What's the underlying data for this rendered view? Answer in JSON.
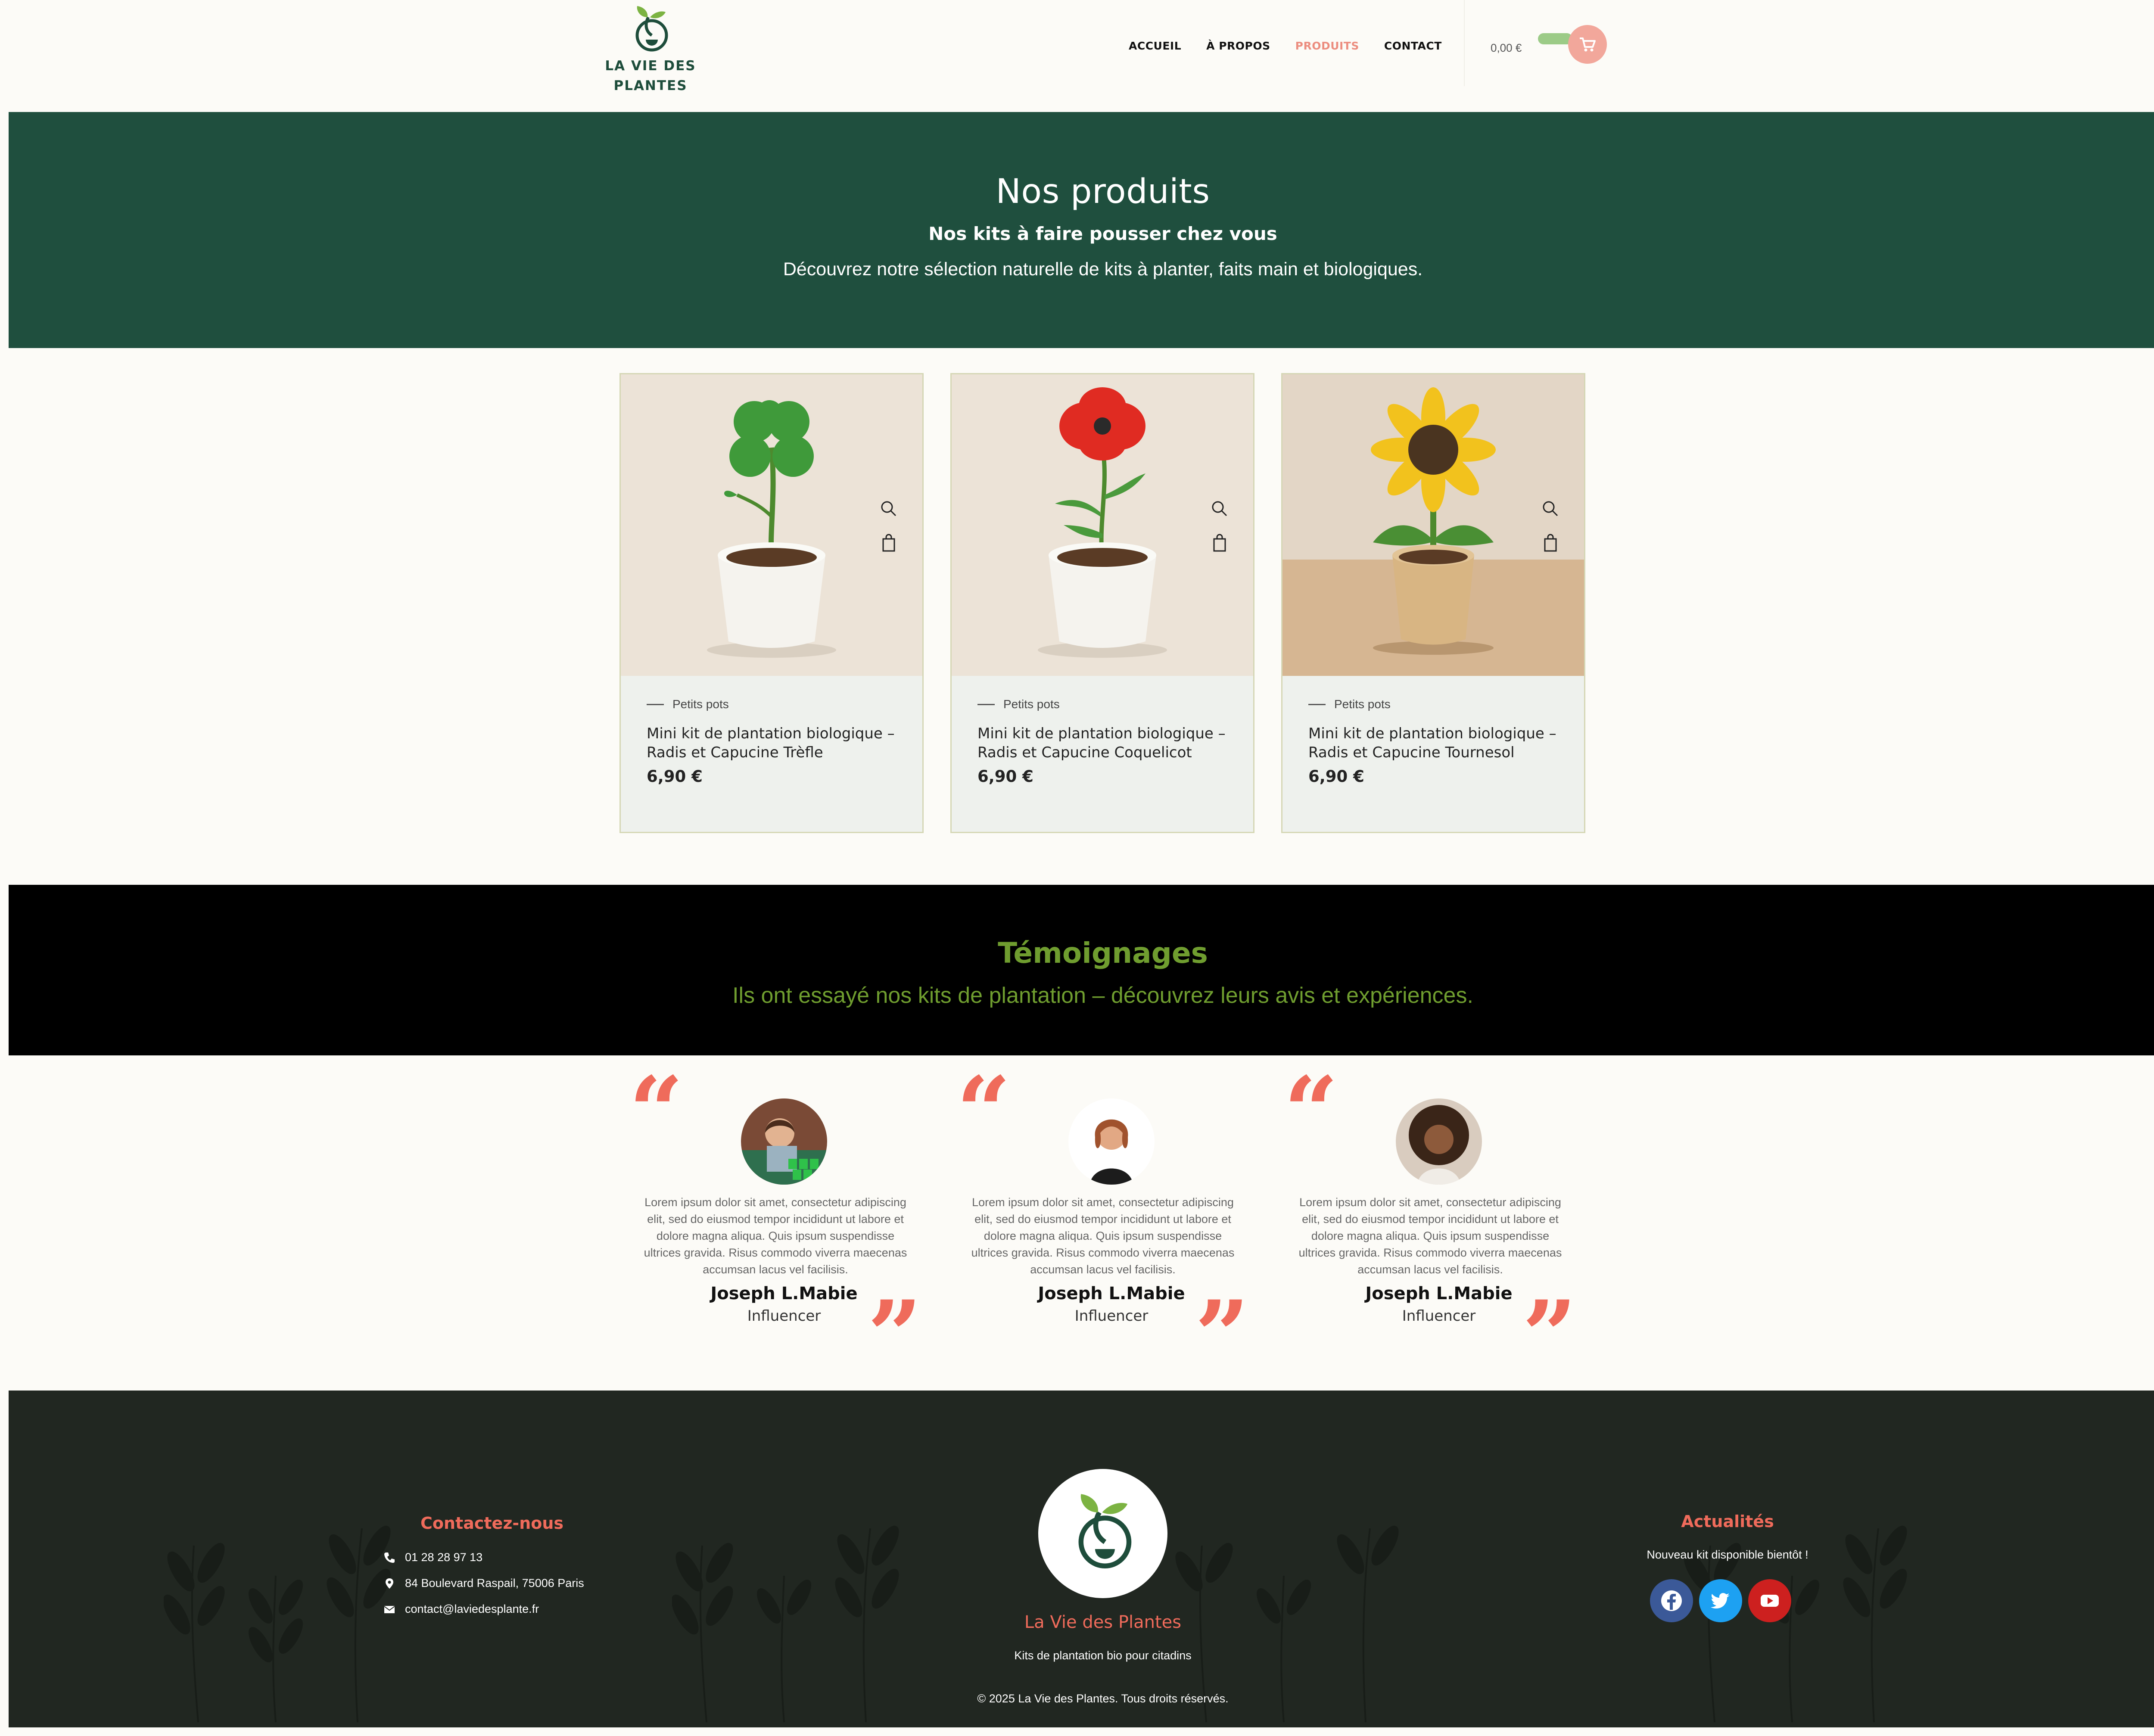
{
  "header": {
    "logo_line1": "LA VIE DES",
    "logo_line2": "PLANTES",
    "nav": [
      {
        "label": "ACCUEIL"
      },
      {
        "label": "À PROPOS"
      },
      {
        "label": "PRODUITS",
        "active": true
      },
      {
        "label": "CONTACT"
      }
    ],
    "cart_total": "0,00 €"
  },
  "hero": {
    "title": "Nos produits",
    "subtitle": "Nos kits à faire pousser chez vous",
    "description": "Découvrez notre sélection naturelle de kits à planter, faits main et biologiques."
  },
  "products": [
    {
      "category": "Petits pots",
      "name_line1": "Mini kit de plantation biologique –",
      "name_line2": "Radis et Capucine Trèfle",
      "price": "6,90 €",
      "image_icon": "clover-plant"
    },
    {
      "category": "Petits pots",
      "name_line1": "Mini kit de plantation biologique –",
      "name_line2": "Radis et Capucine Coquelicot",
      "price": "6,90 €",
      "image_icon": "poppy-plant"
    },
    {
      "category": "Petits pots",
      "name_line1": "Mini kit de plantation biologique –",
      "name_line2": "Radis et Capucine Tournesol",
      "price": "6,90 €",
      "image_icon": "sunflower-plant"
    }
  ],
  "testimonials_section": {
    "title": "Témoignages",
    "subtitle": "Ils ont essayé nos kits de plantation – découvrez leurs avis et expériences."
  },
  "testimonials": [
    {
      "text": "Lorem ipsum dolor sit amet, consectetur adipiscing elit, sed do eiusmod tempor incididunt ut labore et dolore magna aliqua. Quis ipsum suspendisse ultrices gravida. Risus commodo viverra maecenas accumsan lacus vel facilisis.",
      "name": "Joseph L.Mabie",
      "role": "Influencer"
    },
    {
      "text": "Lorem ipsum dolor sit amet, consectetur adipiscing elit, sed do eiusmod tempor incididunt ut labore et dolore magna aliqua. Quis ipsum suspendisse ultrices gravida. Risus commodo viverra maecenas accumsan lacus vel facilisis.",
      "name": "Joseph L.Mabie",
      "role": "Influencer"
    },
    {
      "text": "Lorem ipsum dolor sit amet, consectetur adipiscing elit, sed do eiusmod tempor incididunt ut labore et dolore magna aliqua. Quis ipsum suspendisse ultrices gravida. Risus commodo viverra maecenas accumsan lacus vel facilisis.",
      "name": "Joseph L.Mabie",
      "role": "Influencer"
    }
  ],
  "footer": {
    "contact_title": "Contactez-nous",
    "phone": "01 28 28 97 13",
    "address": "84 Boulevard Raspail, 75006 Paris",
    "email": "contact@laviedesplante.fr",
    "brand": "La Vie des Plantes",
    "tagline": "Kits de plantation bio pour citadins",
    "copyright": "© 2025 La Vie des Plantes. Tous droits réservés.",
    "news_title": "Actualités",
    "news_text": "Nouveau kit disponible bientôt !",
    "socials": [
      "facebook-icon",
      "twitter-icon",
      "youtube-icon"
    ]
  },
  "colors": {
    "brand_green": "#1f4f3e",
    "accent_coral": "#ef6b5b",
    "testimonial_green": "#6f9d2f",
    "footer_bg": "#212721"
  }
}
